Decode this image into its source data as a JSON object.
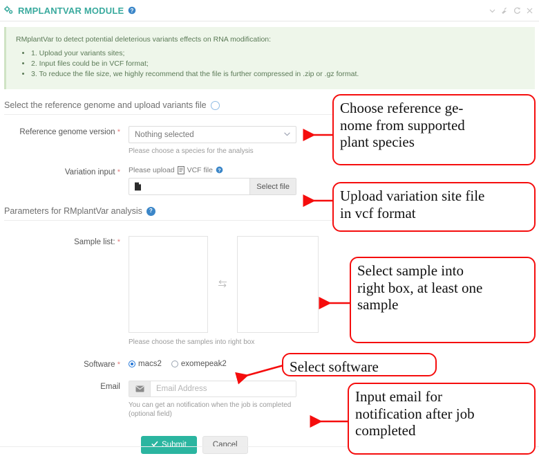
{
  "header": {
    "title": "RMPLANTVAR MODULE",
    "gears_icon": "gears-icon",
    "help_icon": "help-icon",
    "controls": [
      {
        "name": "collapse-icon",
        "glyph": "chevron-down"
      },
      {
        "name": "settings-wrench-icon",
        "glyph": "wrench"
      },
      {
        "name": "refresh-icon",
        "glyph": "refresh"
      },
      {
        "name": "close-icon",
        "glyph": "close"
      }
    ]
  },
  "info": {
    "lead": "RMplantVar to detect potential deleterious variants effects on RNA modification:",
    "items": [
      "1. Upload your variants sites;",
      "2. Input files could be in VCF format;",
      "3. To reduce the file size, we highly recommend that the file is further compressed in .zip or .gz format."
    ]
  },
  "section1": {
    "title": "Select the reference genome and upload variants file",
    "help_icon": "help-icon",
    "genome": {
      "label": "Reference genome version",
      "required": "*",
      "value": "Nothing selected",
      "caret_icon": "chevron-down-icon",
      "hint": "Please choose a species for the analysis"
    },
    "variation": {
      "label": "Variation input",
      "required": "*",
      "upload_prefix": "Please upload",
      "upload_suffix": "VCF file",
      "vcf_icon": "vcf-file-icon",
      "help_icon": "help-icon",
      "file_icon": "file-icon",
      "file_value": "",
      "button": "Select file"
    }
  },
  "section2": {
    "title": "Parameters for RMplantVar analysis",
    "help_icon": "help-icon",
    "sample": {
      "label": "Sample list:",
      "required": "*",
      "left_items": [],
      "right_items": [],
      "swap_icon": "swap-horizontal-icon",
      "hint": "Please choose the samples into right box"
    },
    "software": {
      "label": "Software",
      "required": "*",
      "options": [
        {
          "label": "macs2",
          "checked": true
        },
        {
          "label": "exomepeak2",
          "checked": false
        }
      ]
    },
    "email": {
      "label": "Email",
      "envelope_icon": "envelope-icon",
      "value": "",
      "placeholder": "Email Address",
      "hint_line1": "You can get an notification when the job is completed",
      "hint_line2": "(optional field)"
    }
  },
  "actions": {
    "submit": "Submit",
    "submit_icon": "check-icon",
    "cancel": "Cancel"
  },
  "annotations": [
    {
      "id": "a1",
      "text": "Choose reference ge-\nnome from supported\nplant species"
    },
    {
      "id": "a2",
      "text": "Upload variation site file\nin vcf format"
    },
    {
      "id": "a3",
      "text": "Select sample into\nright box, at least one\nsample"
    },
    {
      "id": "a4",
      "text": "Select software"
    },
    {
      "id": "a5",
      "text": "Input email for\nnotification after job\ncompleted"
    }
  ],
  "colors": {
    "accent_teal": "#3aaa9e",
    "submit_teal": "#2bb5a0",
    "annotation_red": "#f50d0d",
    "info_green_bg": "#eef6ea",
    "info_green_text": "#5b7a57",
    "radio_blue": "#2376d8",
    "help_blue": "#3b86c8"
  }
}
